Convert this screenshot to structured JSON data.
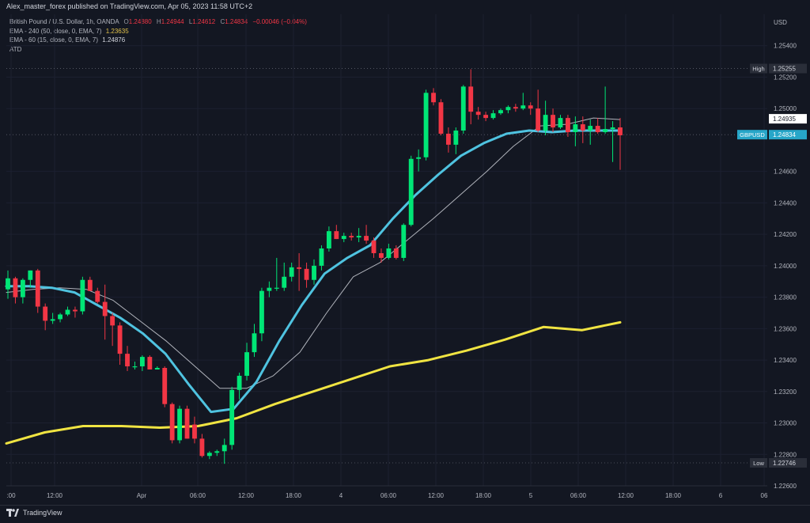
{
  "header": {
    "publisher": "Alex_master_forex published on TradingView.com, Apr 05, 2023 11:58 UTC+2"
  },
  "legend": {
    "symbol": "British Pound / U.S. Dollar, 1h, OANDA",
    "o_label": "O",
    "o_value": "1.24880",
    "h_label": "H",
    "h_value": "1.24944",
    "l_label": "L",
    "l_value": "1.24612",
    "c_label": "C",
    "c_value": "1.24834",
    "change": "−0.00046 (−0.04%)",
    "ema240_label": "EMA - 240 (50, close, 0, EMA, 7)",
    "ema240_value": "1.23635",
    "ema60_label": "EMA - 60 (15, close, 0, EMA, 7)",
    "ema60_value": "1.24876",
    "atd_label": "ATD"
  },
  "axis": {
    "currency": "USD"
  },
  "footer": {
    "brand": "TradingView"
  },
  "colors": {
    "background": "#131722",
    "up": "#00e676",
    "down": "#f23645",
    "ema_fast": "#4fc3e0",
    "ema_slow_thin": "#b0b3bb",
    "ema_long": "#f0e442"
  },
  "chart_data": {
    "type": "candlestick",
    "ylim": [
      1.226,
      1.256
    ],
    "y_ticks": [
      "1.25400",
      "1.25200",
      "1.25000",
      "1.24600",
      "1.24400",
      "1.24200",
      "1.24000",
      "1.23800",
      "1.23600",
      "1.23400",
      "1.23200",
      "1.23000",
      "1.22800",
      "1.22600"
    ],
    "x_ticks": [
      ":00",
      "12:00",
      "Apr",
      "06:00",
      "12:00",
      "18:00",
      "4",
      "06:00",
      "12:00",
      "18:00",
      "5",
      "06:00",
      "12:00",
      "18:00",
      "6",
      "06"
    ],
    "labels": {
      "high": {
        "name": "High",
        "value": "1.25255",
        "price": 1.25255
      },
      "low": {
        "name": "Low",
        "value": "1.22746",
        "price": 1.22746
      },
      "ema_tag": {
        "value": "1.24935",
        "price": 1.24935
      },
      "symbol_tag": {
        "name": "GBPUSD",
        "value": "1.24834",
        "price": 1.24834
      }
    },
    "candles": [
      [
        1.2385,
        1.2397,
        1.2379,
        1.2392
      ],
      [
        1.2392,
        1.2393,
        1.2376,
        1.238
      ],
      [
        1.238,
        1.2392,
        1.2376,
        1.2391
      ],
      [
        1.2391,
        1.2397,
        1.2386,
        1.2397
      ],
      [
        1.2397,
        1.2398,
        1.237,
        1.2374
      ],
      [
        1.2374,
        1.2376,
        1.2359,
        1.2365
      ],
      [
        1.2365,
        1.237,
        1.2363,
        1.2366
      ],
      [
        1.2366,
        1.237,
        1.2364,
        1.2369
      ],
      [
        1.2369,
        1.2374,
        1.2368,
        1.2372
      ],
      [
        1.2372,
        1.2374,
        1.2367,
        1.2371
      ],
      [
        1.2371,
        1.2393,
        1.2369,
        1.2391
      ],
      [
        1.2391,
        1.2393,
        1.2386,
        1.2384
      ],
      [
        1.2384,
        1.2386,
        1.2376,
        1.2377
      ],
      [
        1.2377,
        1.2388,
        1.2353,
        1.2368
      ],
      [
        1.2368,
        1.237,
        1.2349,
        1.2362
      ],
      [
        1.2362,
        1.2364,
        1.2337,
        1.2344
      ],
      [
        1.2344,
        1.2349,
        1.2333,
        1.2336
      ],
      [
        1.2336,
        1.2339,
        1.2334,
        1.2336
      ],
      [
        1.2336,
        1.2343,
        1.2333,
        1.2342
      ],
      [
        1.2342,
        1.2343,
        1.2334,
        1.2334
      ],
      [
        1.2334,
        1.2336,
        1.2334,
        1.2335
      ],
      [
        1.2335,
        1.2336,
        1.231,
        1.2312
      ],
      [
        1.2312,
        1.2313,
        1.2287,
        1.2289
      ],
      [
        1.2289,
        1.2311,
        1.2287,
        1.2309
      ],
      [
        1.2309,
        1.2311,
        1.229,
        1.229
      ],
      [
        1.2299,
        1.2304,
        1.2287,
        1.229
      ],
      [
        1.229,
        1.2293,
        1.2278,
        1.2279
      ],
      [
        1.2279,
        1.2282,
        1.2277,
        1.2281
      ],
      [
        1.2281,
        1.2283,
        1.2279,
        1.2282
      ],
      [
        1.2282,
        1.229,
        1.2274,
        1.2286
      ],
      [
        1.2286,
        1.2323,
        1.2283,
        1.2321
      ],
      [
        1.2321,
        1.2332,
        1.2315,
        1.233
      ],
      [
        1.233,
        1.2351,
        1.2327,
        1.2345
      ],
      [
        1.2345,
        1.2363,
        1.2342,
        1.2357
      ],
      [
        1.2357,
        1.2386,
        1.2352,
        1.2384
      ],
      [
        1.2384,
        1.239,
        1.238,
        1.2386
      ],
      [
        1.2386,
        1.2405,
        1.2384,
        1.2386
      ],
      [
        1.2386,
        1.2402,
        1.2384,
        1.2393
      ],
      [
        1.2393,
        1.2402,
        1.239,
        1.2399
      ],
      [
        1.2399,
        1.2408,
        1.2384,
        1.2398
      ],
      [
        1.2398,
        1.2402,
        1.2386,
        1.2391
      ],
      [
        1.2391,
        1.2404,
        1.2388,
        1.24
      ],
      [
        1.24,
        1.2413,
        1.2397,
        1.2411
      ],
      [
        1.2411,
        1.2425,
        1.2409,
        1.2422
      ],
      [
        1.2422,
        1.2426,
        1.2417,
        1.2417
      ],
      [
        1.2417,
        1.2421,
        1.2415,
        1.2419
      ],
      [
        1.2419,
        1.2421,
        1.2416,
        1.2418
      ],
      [
        1.2418,
        1.2424,
        1.2415,
        1.2419
      ],
      [
        1.2419,
        1.2426,
        1.2414,
        1.2416
      ],
      [
        1.2416,
        1.2418,
        1.2405,
        1.2408
      ],
      [
        1.2408,
        1.2411,
        1.2402,
        1.2405
      ],
      [
        1.2405,
        1.2414,
        1.2404,
        1.2411
      ],
      [
        1.2411,
        1.2413,
        1.2404,
        1.2405
      ],
      [
        1.2405,
        1.2427,
        1.2403,
        1.2426
      ],
      [
        1.2426,
        1.247,
        1.2425,
        1.2468
      ],
      [
        1.2468,
        1.2474,
        1.246,
        1.2469
      ],
      [
        1.2469,
        1.2512,
        1.2467,
        1.251
      ],
      [
        1.251,
        1.2513,
        1.2502,
        1.2504
      ],
      [
        1.2504,
        1.2506,
        1.2483,
        1.2484
      ],
      [
        1.2484,
        1.2488,
        1.2472,
        1.2477
      ],
      [
        1.2477,
        1.2488,
        1.2471,
        1.2486
      ],
      [
        1.2486,
        1.2515,
        1.2484,
        1.2514
      ],
      [
        1.2514,
        1.2525,
        1.249,
        1.2498
      ],
      [
        1.2498,
        1.2501,
        1.2493,
        1.2496
      ],
      [
        1.2496,
        1.2498,
        1.2492,
        1.2494
      ],
      [
        1.2494,
        1.2499,
        1.2493,
        1.2497
      ],
      [
        1.2497,
        1.25,
        1.2496,
        1.2499
      ],
      [
        1.2499,
        1.2502,
        1.2497,
        1.2501
      ],
      [
        1.2501,
        1.2503,
        1.2498,
        1.25
      ],
      [
        1.25,
        1.251,
        1.2499,
        1.2502
      ],
      [
        1.2502,
        1.2504,
        1.2496,
        1.25
      ],
      [
        1.25,
        1.2512,
        1.2485,
        1.2486
      ],
      [
        1.2486,
        1.2505,
        1.2483,
        1.2496
      ],
      [
        1.2496,
        1.25,
        1.2485,
        1.2488
      ],
      [
        1.2488,
        1.2496,
        1.2487,
        1.2494
      ],
      [
        1.2494,
        1.2496,
        1.2482,
        1.2485
      ],
      [
        1.2485,
        1.2495,
        1.2476,
        1.249
      ],
      [
        1.249,
        1.2495,
        1.2478,
        1.2486
      ],
      [
        1.2486,
        1.2493,
        1.2477,
        1.2489
      ],
      [
        1.2489,
        1.2494,
        1.2484,
        1.2485
      ],
      [
        1.2485,
        1.2514,
        1.2484,
        1.2487
      ],
      [
        1.2487,
        1.2492,
        1.2466,
        1.2488
      ],
      [
        1.2488,
        1.2494,
        1.2461,
        1.2483
      ]
    ],
    "ema_fast": [
      1.2387,
      1.2387,
      1.2386,
      1.2383,
      1.2375,
      1.2367,
      1.2357,
      1.2344,
      1.2325,
      1.2307,
      1.2309,
      1.2326,
      1.2352,
      1.2375,
      1.2395,
      1.2405,
      1.2413,
      1.243,
      1.2445,
      1.2458,
      1.247,
      1.2478,
      1.2484,
      1.2486,
      1.2485,
      1.2486,
      1.2486,
      1.2486
    ],
    "ema_slow_thin": [
      1.2383,
      1.2385,
      1.2386,
      1.2385,
      1.2378,
      1.2365,
      1.2352,
      1.2337,
      1.2322,
      1.2322,
      1.233,
      1.2345,
      1.237,
      1.2393,
      1.2402,
      1.2416,
      1.243,
      1.2445,
      1.246,
      1.2476,
      1.2489,
      1.249,
      1.2494,
      1.2493
    ],
    "ema_long": [
      1.2287,
      1.2294,
      1.2298,
      1.2298,
      1.2297,
      1.2298,
      1.2303,
      1.2312,
      1.232,
      1.2328,
      1.2336,
      1.234,
      1.2346,
      1.2353,
      1.2361,
      1.2359,
      1.2364
    ]
  }
}
